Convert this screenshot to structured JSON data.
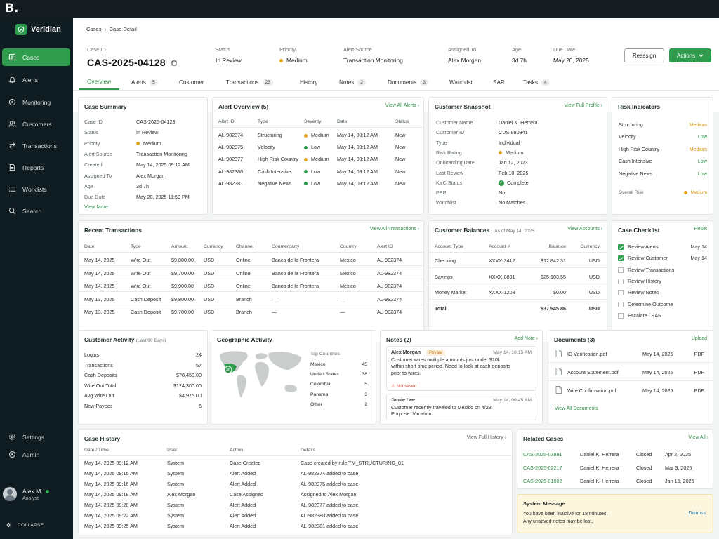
{
  "brand_badge": "B.",
  "app": {
    "name": "Veridian"
  },
  "sidebar": {
    "items": [
      {
        "label": "Cases",
        "icon": "cases-icon",
        "active": true
      },
      {
        "label": "Alerts",
        "icon": "bell-icon"
      },
      {
        "label": "Monitoring",
        "icon": "monitoring-icon"
      },
      {
        "label": "Customers",
        "icon": "users-icon"
      },
      {
        "label": "Transactions",
        "icon": "transfer-icon"
      },
      {
        "label": "Reports",
        "icon": "report-icon"
      },
      {
        "label": "Worklists",
        "icon": "list-icon"
      },
      {
        "label": "Search",
        "icon": "search-icon"
      }
    ],
    "bottom": [
      {
        "label": "Settings",
        "icon": "gear-icon"
      },
      {
        "label": "Admin",
        "icon": "admin-icon"
      }
    ],
    "user": {
      "name": "Alex M.",
      "role": "Analyst"
    },
    "collapse": "COLLAPSE"
  },
  "breadcrumb": {
    "root": "Cases",
    "current": "Case Detail"
  },
  "header": {
    "case_id_label": "Case ID",
    "case_id": "CAS-2025-04128",
    "status_label": "Status",
    "status": "In Review",
    "priority_label": "Priority",
    "priority": "Medium",
    "source_label": "Alert Source",
    "source": "Transaction Monitoring",
    "assigned_label": "Assigned To",
    "assigned": "Alex Morgan",
    "age_label": "Age",
    "age": "3d 7h",
    "due_label": "Due Date",
    "due": "May 20, 2025",
    "reassign": "Reassign",
    "actions": "Actions"
  },
  "tabs": [
    {
      "label": "Overview",
      "active": true
    },
    {
      "label": "Alerts",
      "count": "5"
    },
    {
      "label": "Customer"
    },
    {
      "label": "Transactions",
      "count": "23"
    },
    {
      "label": "History"
    },
    {
      "label": "Notes",
      "count": "2"
    },
    {
      "label": "Documents",
      "count": "3"
    },
    {
      "label": "Watchlist"
    },
    {
      "label": "SAR"
    },
    {
      "label": "Tasks",
      "count": "4"
    }
  ],
  "case_summary": {
    "title": "Case Summary",
    "rows": [
      [
        "Case ID",
        "CAS-2025-04128"
      ],
      [
        "Status",
        "In Review"
      ],
      [
        "Priority",
        "Medium"
      ],
      [
        "Alert Source",
        "Transaction Monitoring"
      ],
      [
        "Created",
        "May 14, 2025 09:12 AM"
      ],
      [
        "Assigned To",
        "Alex Morgan"
      ],
      [
        "Age",
        "3d 7h"
      ],
      [
        "Due Date",
        "May 20, 2025 11:59 PM"
      ]
    ],
    "more": "View More"
  },
  "alert_overview": {
    "title": "Alert Overview (5)",
    "link": "View All Alerts",
    "headers": [
      "Alert ID",
      "Type",
      "Severity",
      "Date",
      "Status"
    ],
    "rows": [
      [
        "AL-982374",
        "Structuring",
        "Medium",
        "May 14, 09:12 AM",
        "New"
      ],
      [
        "AL-982375",
        "Velocity",
        "Low",
        "May 14, 09:12 AM",
        "New"
      ],
      [
        "AL-982377",
        "High Risk Country",
        "Medium",
        "May 14, 09:12 AM",
        "New"
      ],
      [
        "AL-982380",
        "Cash Intensive",
        "Low",
        "May 14, 09:12 AM",
        "New"
      ],
      [
        "AL-982381",
        "Negative News",
        "Low",
        "May 14, 09:12 AM",
        "New"
      ]
    ]
  },
  "customer_snapshot": {
    "title": "Customer Snapshot",
    "link": "View Full Profile",
    "rows": [
      [
        "Customer Name",
        "Daniel K. Herrera"
      ],
      [
        "Customer ID",
        "CUS-880341"
      ],
      [
        "Type",
        "Individual"
      ],
      [
        "Risk Rating",
        "Medium"
      ],
      [
        "Onboarding Date",
        "Jan 12, 2023"
      ],
      [
        "Last Review",
        "Feb 10, 2025"
      ],
      [
        "KYC Status",
        "Complete"
      ],
      [
        "PEP",
        "No"
      ],
      [
        "Watchlist",
        "No Matches"
      ]
    ]
  },
  "risk_indicators": {
    "title": "Risk Indicators",
    "rows": [
      [
        "Structuring",
        "Medium"
      ],
      [
        "Velocity",
        "Low"
      ],
      [
        "High Risk Country",
        "Medium"
      ],
      [
        "Cash Intensive",
        "Low"
      ],
      [
        "Negative News",
        "Low"
      ]
    ],
    "overall_label": "Overall Risk",
    "overall": "Medium"
  },
  "recent_transactions": {
    "title": "Recent Transactions",
    "link": "View All Transactions",
    "headers": [
      "Date",
      "Type",
      "Amount",
      "Currency",
      "Channel",
      "Counterparty",
      "Country",
      "Alert ID"
    ],
    "rows": [
      [
        "May 14, 2025",
        "Wire Out",
        "$9,800.00",
        "USD",
        "Online",
        "Banco de la Frontera",
        "Mexico",
        "AL-982374"
      ],
      [
        "May 14, 2025",
        "Wire Out",
        "$9,700.00",
        "USD",
        "Online",
        "Banco de la Frontera",
        "Mexico",
        "AL-982374"
      ],
      [
        "May 14, 2025",
        "Wire Out",
        "$9,900.00",
        "USD",
        "Online",
        "Banco de la Frontera",
        "Mexico",
        "AL-982374"
      ],
      [
        "May 13, 2025",
        "Cash Deposit",
        "$9,800.00",
        "USD",
        "Branch",
        "—",
        "—",
        "AL-982374"
      ],
      [
        "May 13, 2025",
        "Cash Deposit",
        "$9,700.00",
        "USD",
        "Branch",
        "—",
        "—",
        "AL-982374"
      ]
    ]
  },
  "balances": {
    "title": "Customer Balances",
    "asof": "As of May 14, 2025",
    "link": "View Accounts",
    "headers": [
      "Account Type",
      "Account #",
      "Balance",
      "Currency"
    ],
    "rows": [
      [
        "Checking",
        "XXXX-3412",
        "$12,842.31",
        "USD"
      ],
      [
        "Savings",
        "XXXX-8891",
        "$25,103.55",
        "USD"
      ],
      [
        "Money Market",
        "XXXX-1203",
        "$0.00",
        "USD"
      ]
    ],
    "total": [
      "Total",
      "$37,945.86",
      "USD"
    ]
  },
  "checklist": {
    "title": "Case Checklist",
    "reset": "Reset",
    "items": [
      {
        "label": "Review Alerts",
        "done": true,
        "date": "May 14"
      },
      {
        "label": "Review Customer",
        "done": true,
        "date": "May 14"
      },
      {
        "label": "Review Transactions",
        "done": false,
        "date": ""
      },
      {
        "label": "Review History",
        "done": false,
        "date": ""
      },
      {
        "label": "Review Notes",
        "done": false,
        "date": ""
      },
      {
        "label": "Determine Outcome",
        "done": false,
        "date": ""
      },
      {
        "label": "Escalate / SAR",
        "done": false,
        "date": ""
      }
    ]
  },
  "activity": {
    "title": "Customer Activity",
    "period": "(Last 90 Days)",
    "rows": [
      [
        "Logins",
        "24"
      ],
      [
        "Transactions",
        "57"
      ],
      [
        "Cash Deposits",
        "$78,450.00"
      ],
      [
        "Wire Out Total",
        "$124,300.00"
      ],
      [
        "Avg Wire Out",
        "$4,975.00"
      ],
      [
        "New Payees",
        "6"
      ]
    ]
  },
  "geo": {
    "title": "Geographic Activity",
    "map_marker": "48",
    "top_label": "Top Countries",
    "rows": [
      [
        "Mexico",
        "45"
      ],
      [
        "United States",
        "38"
      ],
      [
        "Colombia",
        "5"
      ],
      [
        "Panama",
        "3"
      ],
      [
        "Other",
        "2"
      ]
    ]
  },
  "notes": {
    "title": "Notes (2)",
    "add": "Add Note",
    "items": [
      {
        "author": "Alex Morgan",
        "tag": "Private",
        "time": "May 14, 10:15 AM",
        "text": "Customer wires multiple amounts just under $10k within short time period. Need to look at cash deposits prior to wires.",
        "warn": "Not saved"
      },
      {
        "author": "Jamie Lee",
        "tag": "",
        "time": "May 14, 09:45 AM",
        "text": "Customer recently traveled to Mexico on 4/28. Purpose: Vacation.",
        "warn": ""
      }
    ]
  },
  "documents": {
    "title": "Documents (3)",
    "upload": "Upload",
    "items": [
      [
        "ID Verification.pdf",
        "May 14, 2025",
        "PDF"
      ],
      [
        "Account Statement.pdf",
        "May 14, 2025",
        "PDF"
      ],
      [
        "Wire Confirmation.pdf",
        "May 14, 2025",
        "PDF"
      ]
    ],
    "link": "View All Documents"
  },
  "history": {
    "title": "Case History",
    "link": "View Full History",
    "headers": [
      "Date / Time",
      "User",
      "Action",
      "Details"
    ],
    "rows": [
      [
        "May 14, 2025 09:12 AM",
        "System",
        "Case Created",
        "Case created by rule TM_STRUCTURING_01"
      ],
      [
        "May 14, 2025 09:15 AM",
        "System",
        "Alert Added",
        "AL-982374 added to case"
      ],
      [
        "May 14, 2025 09:16 AM",
        "System",
        "Alert Added",
        "AL-982375 added to case"
      ],
      [
        "May 14, 2025 09:18 AM",
        "Alex Morgan",
        "Case Assigned",
        "Assigned to Alex Morgan"
      ],
      [
        "May 14, 2025 09:20 AM",
        "System",
        "Alert Added",
        "AL-982377 added to case"
      ],
      [
        "May 14, 2025 09:22 AM",
        "System",
        "Alert Added",
        "AL-982380 added to case"
      ],
      [
        "May 14, 2025 09:25 AM",
        "System",
        "Alert Added",
        "AL-982381 added to case"
      ]
    ]
  },
  "related": {
    "title": "Related Cases",
    "link": "View All",
    "rows": [
      [
        "CAS-2025-03891",
        "Daniel K. Herrera",
        "Closed",
        "Apr 2, 2025"
      ],
      [
        "CAS-2025-02217",
        "Daniel K. Herrera",
        "Closed",
        "Mar 3, 2025"
      ],
      [
        "CAS-2025-01002",
        "Daniel K. Herrera",
        "Closed",
        "Jan 15, 2025"
      ]
    ]
  },
  "system_message": {
    "title": "System Message",
    "line1": "You have been inactive for 18 minutes.",
    "line2": "Any unsaved notes may be lost.",
    "dismiss": "Dismiss"
  },
  "colors": {
    "accent": "#2e9c4c",
    "medium": "#e5a520",
    "sidebar": "#0f1c22"
  }
}
